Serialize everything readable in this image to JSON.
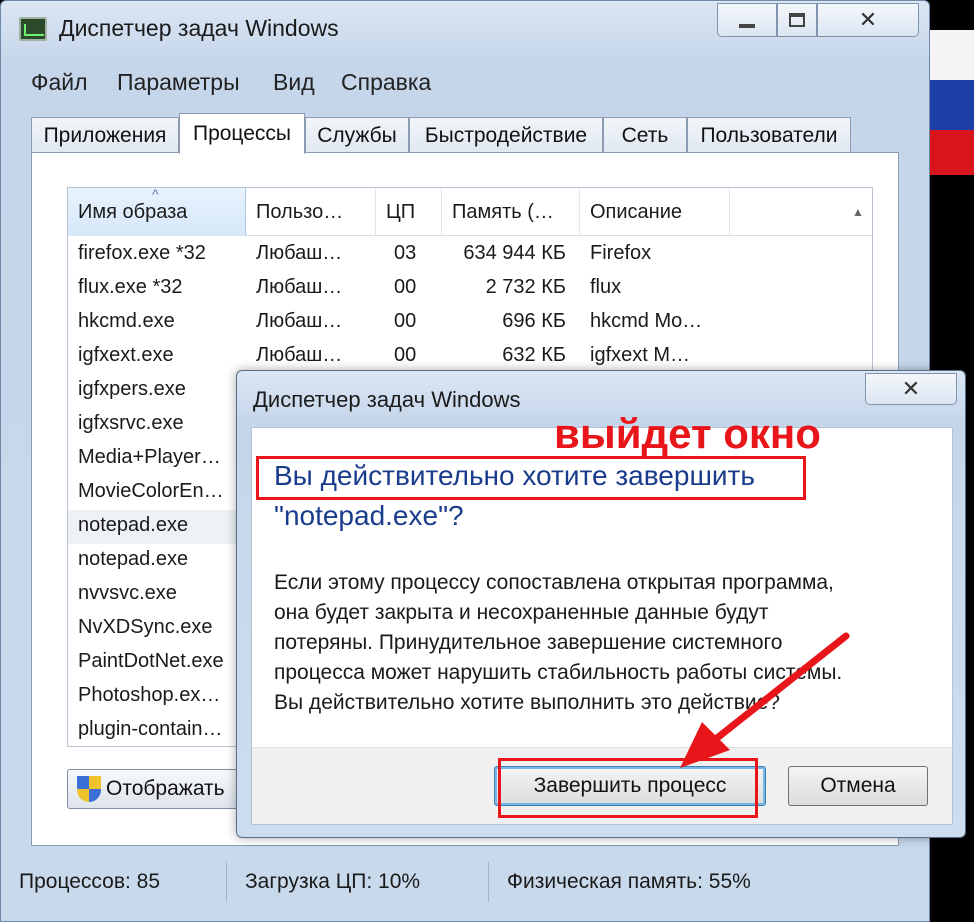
{
  "window": {
    "title": "Диспетчер задач Windows",
    "menu": [
      "Файл",
      "Параметры",
      "Вид",
      "Справка"
    ],
    "tabs": [
      "Приложения",
      "Процессы",
      "Службы",
      "Быстродействие",
      "Сеть",
      "Пользователи"
    ],
    "active_tab": "Процессы"
  },
  "table": {
    "columns": [
      "Имя образа",
      "Пользо…",
      "ЦП",
      "Память (…",
      "Описание"
    ],
    "sorted_column": "Имя образа",
    "rows": [
      {
        "name": "firefox.exe *32",
        "user": "Любаш…",
        "cpu": "03",
        "mem": "634 944 КБ",
        "desc": "Firefox"
      },
      {
        "name": "flux.exe *32",
        "user": "Любаш…",
        "cpu": "00",
        "mem": "2 732 КБ",
        "desc": "flux"
      },
      {
        "name": "hkcmd.exe",
        "user": "Любаш…",
        "cpu": "00",
        "mem": "696 КБ",
        "desc": "hkcmd Mo…"
      },
      {
        "name": "igfxext.exe",
        "user": "Любаш…",
        "cpu": "00",
        "mem": "632 КБ",
        "desc": "igfxext M…"
      },
      {
        "name": "igfxpers.exe",
        "user": "",
        "cpu": "",
        "mem": "",
        "desc": ""
      },
      {
        "name": "igfxsrvc.exe",
        "user": "",
        "cpu": "",
        "mem": "",
        "desc": ""
      },
      {
        "name": "Media+Player…",
        "user": "",
        "cpu": "",
        "mem": "",
        "desc": ""
      },
      {
        "name": "MovieColorEn…",
        "user": "",
        "cpu": "",
        "mem": "",
        "desc": ""
      },
      {
        "name": "notepad.exe",
        "user": "",
        "cpu": "",
        "mem": "",
        "desc": ""
      },
      {
        "name": "notepad.exe",
        "user": "",
        "cpu": "",
        "mem": "",
        "desc": ""
      },
      {
        "name": "nvvsvc.exe",
        "user": "",
        "cpu": "",
        "mem": "",
        "desc": ""
      },
      {
        "name": "NvXDSync.exe",
        "user": "",
        "cpu": "",
        "mem": "",
        "desc": ""
      },
      {
        "name": "PaintDotNet.exe",
        "user": "",
        "cpu": "",
        "mem": "",
        "desc": ""
      },
      {
        "name": "Photoshop.ex…",
        "user": "",
        "cpu": "",
        "mem": "",
        "desc": ""
      },
      {
        "name": "plugin-contain…",
        "user": "",
        "cpu": "",
        "mem": "",
        "desc": ""
      }
    ],
    "selected_row": 8
  },
  "show_all_button": "Отображать",
  "status": {
    "processes": "Процессов: 85",
    "cpu": "Загрузка ЦП: 10%",
    "memory": "Физическая память: 55%"
  },
  "dialog": {
    "title": "Диспетчер задач Windows",
    "annotation": "выйдет окно",
    "question_line1": "Вы действительно хотите завершить",
    "question_line2": "\"notepad.exe\"?",
    "message": [
      "Если этому процессу сопоставлена открытая программа,",
      "она будет закрыта и несохраненные данные будут",
      "потеряны. Принудительное завершение системного",
      "процесса может нарушить стабильность работы системы.",
      "Вы действительно хотите выполнить это действие?"
    ],
    "end_button": "Завершить процесс",
    "cancel_button": "Отмена"
  },
  "colors": {
    "annotation_red": "#e8161a",
    "question_blue": "#1a3c8c",
    "chrome_blue": "#c6d6ea"
  }
}
